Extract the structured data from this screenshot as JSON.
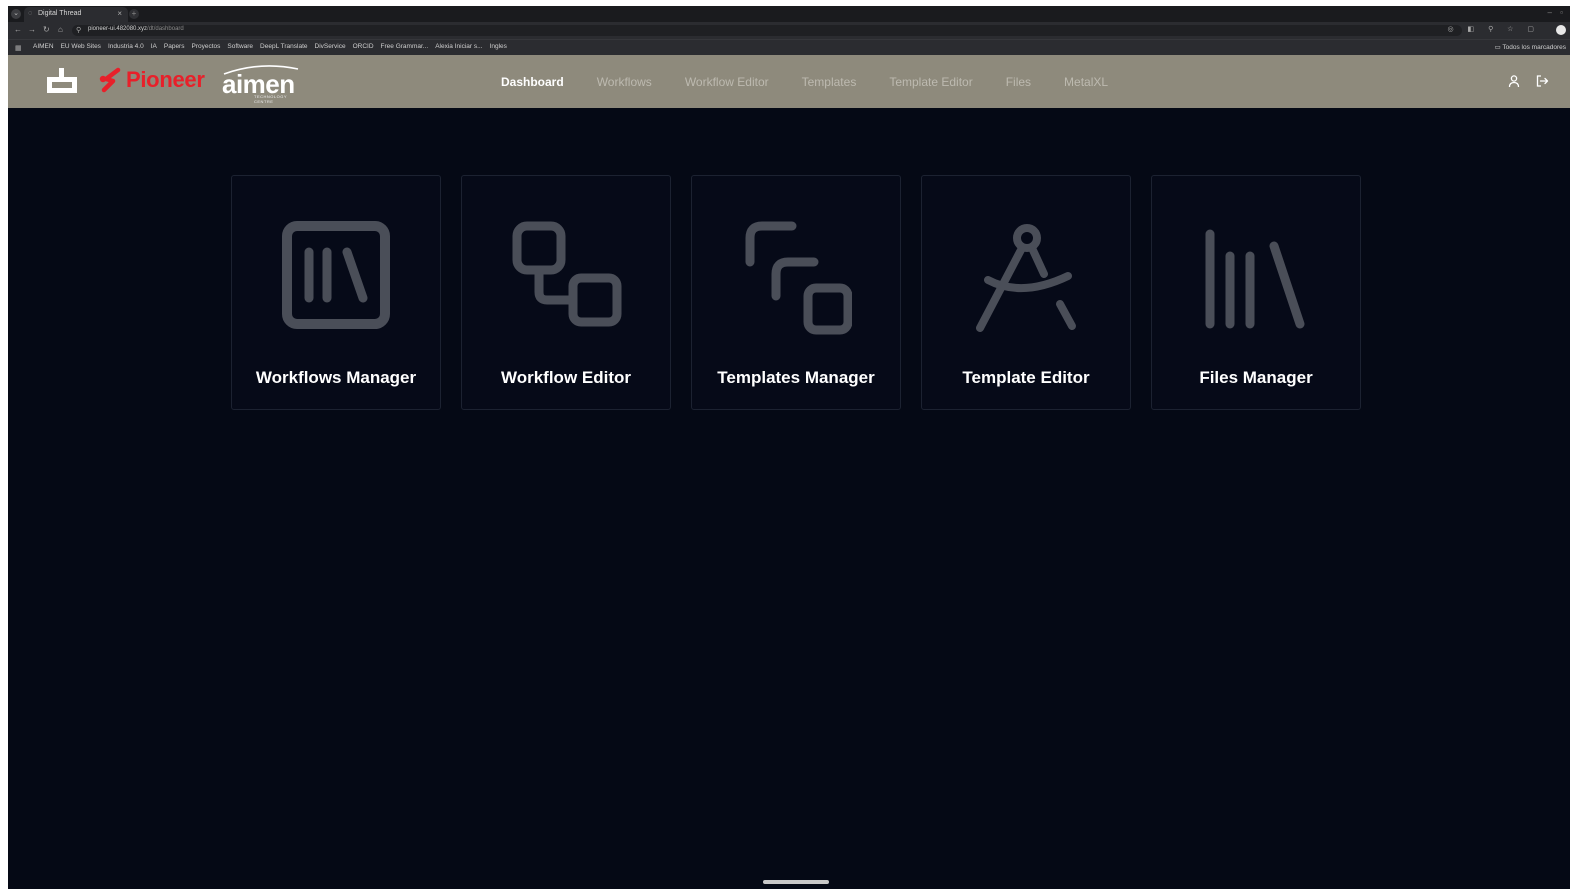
{
  "browser": {
    "tab_title": "Digital Thread",
    "tab_close": "×",
    "new_tab": "+",
    "url_host": "pioneer-ui.482080.xyz",
    "url_path": "/dt/dashboard",
    "bookmarks": [
      "AIMEN",
      "EU Web Sites",
      "Industria 4.0",
      "IA",
      "Papers",
      "Proyectos",
      "Software",
      "DeepL Translate",
      "DivService",
      "ORCID",
      "Free Grammar...",
      "Alexia Iniciar s...",
      "Ingles"
    ],
    "all_bookmarks": "Todos los marcadores"
  },
  "header": {
    "brand_pioneer": "Pioneer",
    "brand_aimen": "aimen",
    "brand_aimen_sub": "TECHNOLOGY CENTRE",
    "nav": [
      {
        "label": "Dashboard",
        "active": true
      },
      {
        "label": "Workflows",
        "active": false
      },
      {
        "label": "Workflow Editor",
        "active": false
      },
      {
        "label": "Templates",
        "active": false
      },
      {
        "label": "Template Editor",
        "active": false
      },
      {
        "label": "Files",
        "active": false
      },
      {
        "label": "MetalXL",
        "active": false
      }
    ],
    "user_icon": "user-icon",
    "logout_icon": "logout-icon"
  },
  "dashboard": {
    "cards": [
      {
        "label": "Workflows Manager",
        "icon": "workflows-board-icon"
      },
      {
        "label": "Workflow Editor",
        "icon": "workflow-nodes-icon"
      },
      {
        "label": "Templates Manager",
        "icon": "templates-stack-icon"
      },
      {
        "label": "Template Editor",
        "icon": "compass-drafting-icon"
      },
      {
        "label": "Files Manager",
        "icon": "library-books-icon"
      }
    ]
  },
  "colors": {
    "header_bg": "#8e8a7c",
    "main_bg": "#050915",
    "card_bg": "#060a18",
    "icon_gray": "#4a4e58",
    "pioneer_red": "#e8202a"
  }
}
